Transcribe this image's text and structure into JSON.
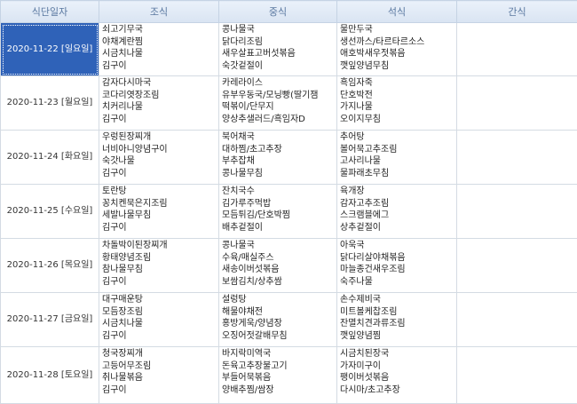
{
  "headers": [
    "식단일자",
    "조식",
    "중식",
    "석식",
    "간식"
  ],
  "rows": [
    {
      "date": "2020-11-22 [일요일]",
      "breakfast": [
        "쇠고기무국",
        "야채계란찜",
        "시금치나물",
        "김구이"
      ],
      "lunch": [
        "콩나물국",
        "닭다리조림",
        "새우살표고버섯볶음",
        "숙갓겉절이"
      ],
      "dinner": [
        "물만두국",
        "생선까스/타르타르소스",
        "애호박새우젓볶음",
        "깻잎양념무침"
      ],
      "snack": ""
    },
    {
      "date": "2020-11-23 [월요일]",
      "breakfast": [
        "감자다시마국",
        "코다리엿장조림",
        "치커리나물",
        "김구이"
      ],
      "lunch": [
        "카레라이스",
        "유부우동국/모닝빵(딸기잼",
        "떡볶이/단무지",
        "양상추샐러드/흑임자D"
      ],
      "dinner": [
        "흑임자죽",
        "단호박전",
        "가지나물",
        "오이지무침"
      ],
      "snack": ""
    },
    {
      "date": "2020-11-24 [화요일]",
      "breakfast": [
        "우렁된장찌개",
        "너비아니양념구이",
        "숙갓나물",
        "김구이"
      ],
      "lunch": [
        "북어채국",
        "대하찜/초고추장",
        "부추잡채",
        "콩나물무침"
      ],
      "dinner": [
        "추어탕",
        "볼어묵고추조림",
        "고사리나물",
        "물파래초무침"
      ],
      "snack": ""
    },
    {
      "date": "2020-11-25 [수요일]",
      "breakfast": [
        "토란탕",
        "꽁치켄묵은지조림",
        "세발나물무침",
        "김구이"
      ],
      "lunch": [
        "잔치국수",
        "김가루주먹밥",
        "모듬튀김/단호박찜",
        "배추겉절이"
      ],
      "dinner": [
        "육개장",
        "감자고추조림",
        "스크램블에그",
        "상추겉절이"
      ],
      "snack": ""
    },
    {
      "date": "2020-11-26 [목요일]",
      "breakfast": [
        "차돌박이된장찌개",
        "황태양념조림",
        "참나물무침",
        "김구이"
      ],
      "lunch": [
        "콩나물국",
        "수육/매실주스",
        "새송이버섯볶음",
        "보쌈김치/상추쌈"
      ],
      "dinner": [
        "아욱국",
        "닭다리살야채볶음",
        "마늘종건새우조림",
        "숙주나물"
      ],
      "snack": ""
    },
    {
      "date": "2020-11-27 [금요일]",
      "breakfast": [
        "대구매운탕",
        "모듬장조림",
        "시금치나물",
        "김구이"
      ],
      "lunch": [
        "설렁탕",
        "해물야채전",
        "홍방게욱/양념장",
        "오징어젓갈배무침"
      ],
      "dinner": [
        "손수제비국",
        "미트볼케찹조림",
        "잔멸치견과류조림",
        "깻잎양념찜"
      ],
      "snack": ""
    },
    {
      "date": "2020-11-28 [토요일]",
      "breakfast": [
        "청국장찌개",
        "고등어무조림",
        "취나물볶음",
        "김구이"
      ],
      "lunch": [
        "바지락미역국",
        "돈육고추장불고기",
        "부들어묵볶음",
        "양배추찜/쌈장"
      ],
      "dinner": [
        "시금치된장국",
        "가자미구이",
        "팽이버섯볶음",
        "다시마/초고추장"
      ],
      "snack": ""
    }
  ]
}
